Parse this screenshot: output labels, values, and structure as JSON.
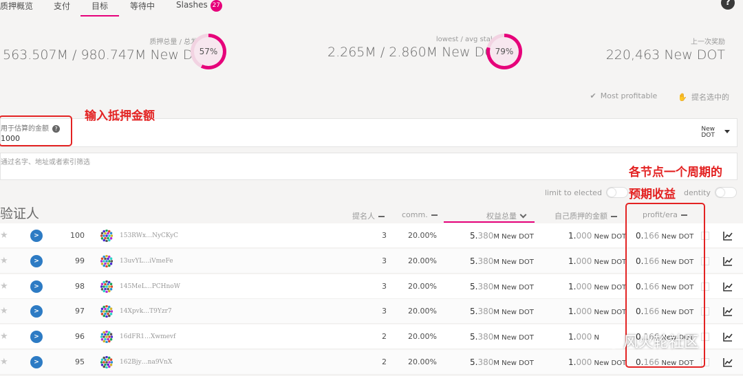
{
  "tabs": [
    {
      "label": "质押概览"
    },
    {
      "label": "支付"
    },
    {
      "label": "目标",
      "active": true
    },
    {
      "label": "等待中"
    },
    {
      "label": "Slashes",
      "badge": "27"
    }
  ],
  "help_icon": "?",
  "summary": {
    "staked": {
      "label": "质押总量 / 总发行量",
      "value": "563.507M / 980.747M New DOT",
      "percent": "57%",
      "fraction": 0.57
    },
    "lowest": {
      "label": "lowest / avg staked",
      "value": "2.265M / 2.860M New DOT",
      "percent": "79%",
      "fraction": 0.79
    },
    "last_reward": {
      "label": "上一次奖励",
      "value": "220,463 New DOT"
    }
  },
  "filters": {
    "most_profitable": "Most profitable",
    "selected": "提名选中的"
  },
  "amount": {
    "label": "用于估算的金额",
    "value": "1000",
    "unit_line1": "New",
    "unit_line2": "DOT"
  },
  "filter_input": {
    "placeholder": "通过名字、地址或者索引筛选"
  },
  "toggles": {
    "limit": "limit to elected",
    "identity": "dentity"
  },
  "table": {
    "title": "验证人",
    "headers": {
      "nominators": "提名人",
      "comm": "comm.",
      "total": "权益总量",
      "own": "自己质押的金额",
      "profit": "profit/era"
    },
    "rows": [
      {
        "rank": "100",
        "address": "153RWx…NyCKyC",
        "nominators": "3",
        "comm": "20.00%",
        "total_hi": "5.",
        "total_lo": "380",
        "total_u": "M New DOT",
        "own_hi": "1.",
        "own_lo": "000",
        "own_u": " New DOT",
        "profit_hi": "0.",
        "profit_lo": "166",
        "profit_u": " New DOT"
      },
      {
        "rank": "99",
        "address": "13uvYL…iVmeFe",
        "nominators": "3",
        "comm": "20.00%",
        "total_hi": "5.",
        "total_lo": "380",
        "total_u": "M New DOT",
        "own_hi": "1.",
        "own_lo": "000",
        "own_u": " New DOT",
        "profit_hi": "0.",
        "profit_lo": "166",
        "profit_u": " New DOT"
      },
      {
        "rank": "98",
        "address": "145MeL…PCHnoW",
        "nominators": "3",
        "comm": "20.00%",
        "total_hi": "5.",
        "total_lo": "380",
        "total_u": "M New DOT",
        "own_hi": "1.",
        "own_lo": "000",
        "own_u": " New DOT",
        "profit_hi": "0.",
        "profit_lo": "166",
        "profit_u": " New DOT"
      },
      {
        "rank": "97",
        "address": "14Xpvk…T9Yzr7",
        "nominators": "3",
        "comm": "20.00%",
        "total_hi": "5.",
        "total_lo": "380",
        "total_u": "M New DOT",
        "own_hi": "1.",
        "own_lo": "000",
        "own_u": " New DOT",
        "profit_hi": "0.",
        "profit_lo": "166",
        "profit_u": " New DOT"
      },
      {
        "rank": "96",
        "address": "16dFR1…Xwmevf",
        "nominators": "2",
        "comm": "20.00%",
        "total_hi": "5.",
        "total_lo": "380",
        "total_u": "M New DOT",
        "own_hi": "1.",
        "own_lo": "000",
        "own_u": " N",
        "profit_hi": "0.",
        "profit_lo": "166",
        "profit_u": " New DOT"
      },
      {
        "rank": "95",
        "address": "162Bjy…na9VnX",
        "nominators": "2",
        "comm": "20.00%",
        "total_hi": "5.",
        "total_lo": "380",
        "total_u": "M New DOT",
        "own_hi": "1.",
        "own_lo": "000",
        "own_u": " New DOT",
        "profit_hi": "0.",
        "profit_lo": "166",
        "profit_u": " New DOT"
      }
    ]
  },
  "annotations": {
    "amount_note": "输入抵押金额",
    "profit_note_1": "各节点一个周期的",
    "profit_note_2": "预期收益"
  },
  "watermark": "风火轮社区",
  "colors": {
    "accent": "#e6007a",
    "nav_blue": "#2d7bc4",
    "annotation_red": "#e32222"
  }
}
